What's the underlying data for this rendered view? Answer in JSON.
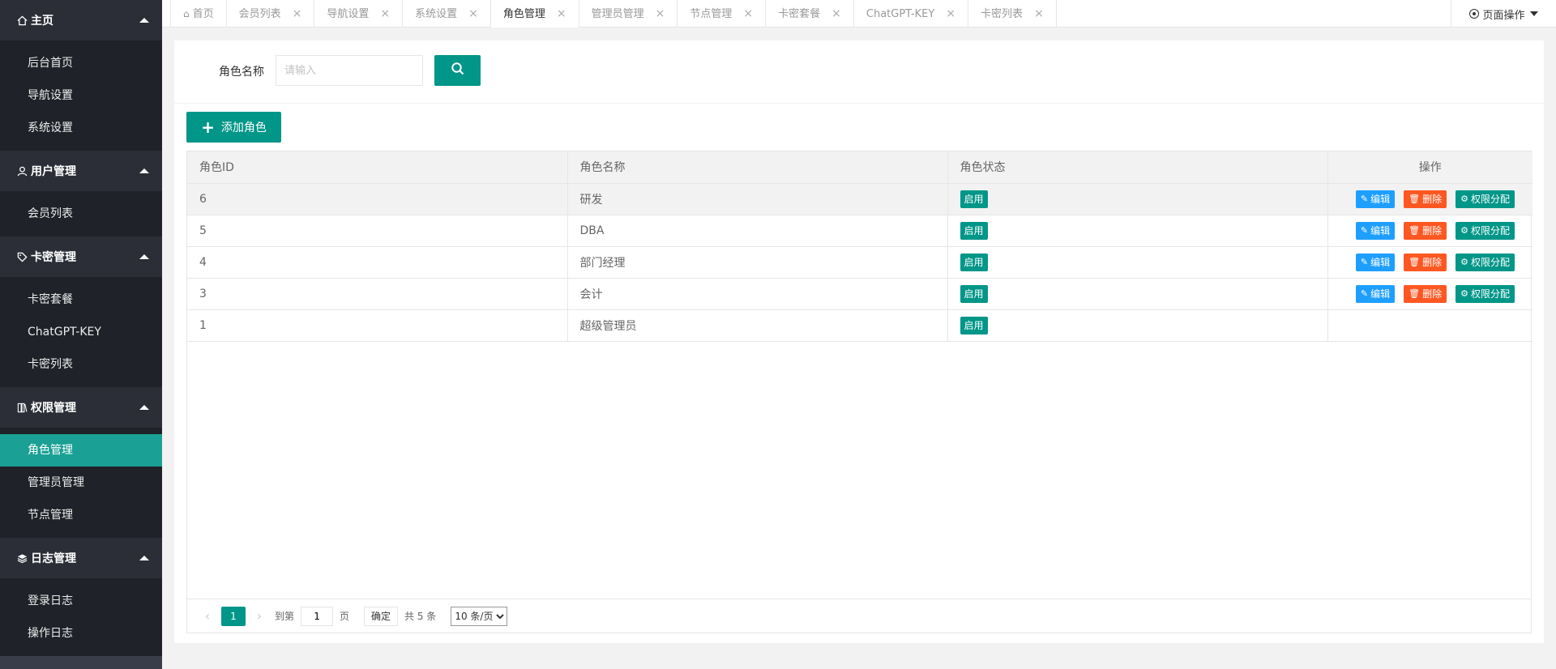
{
  "sidebar": {
    "groups": [
      {
        "label": "主页",
        "icon": "home-icon",
        "items": [
          "后台首页",
          "导航设置",
          "系统设置"
        ]
      },
      {
        "label": "用户管理",
        "icon": "user-icon",
        "items": [
          "会员列表"
        ]
      },
      {
        "label": "卡密管理",
        "icon": "tag-icon",
        "items": [
          "卡密套餐",
          "ChatGPT-KEY",
          "卡密列表"
        ]
      },
      {
        "label": "权限管理",
        "icon": "book-icon",
        "items": [
          "角色管理",
          "管理员管理",
          "节点管理"
        ]
      },
      {
        "label": "日志管理",
        "icon": "layers-icon",
        "items": [
          "登录日志",
          "操作日志"
        ]
      }
    ],
    "active_item": "角色管理"
  },
  "tabs": [
    {
      "label": "首页",
      "closable": false
    },
    {
      "label": "会员列表",
      "closable": true
    },
    {
      "label": "导航设置",
      "closable": true
    },
    {
      "label": "系统设置",
      "closable": true
    },
    {
      "label": "角色管理",
      "closable": true,
      "active": true
    },
    {
      "label": "管理员管理",
      "closable": true
    },
    {
      "label": "节点管理",
      "closable": true
    },
    {
      "label": "卡密套餐",
      "closable": true
    },
    {
      "label": "ChatGPT-KEY",
      "closable": true
    },
    {
      "label": "卡密列表",
      "closable": true
    }
  ],
  "page_ops_label": "页面操作",
  "search": {
    "label": "角色名称",
    "placeholder": "请输入",
    "value": ""
  },
  "add_button_label": "添加角色",
  "table": {
    "columns": [
      "角色ID",
      "角色名称",
      "角色状态",
      "操作"
    ],
    "rows": [
      {
        "id": "6",
        "name": "研发",
        "status": "启用",
        "actions": true
      },
      {
        "id": "5",
        "name": "DBA",
        "status": "启用",
        "actions": true
      },
      {
        "id": "4",
        "name": "部门经理",
        "status": "启用",
        "actions": true
      },
      {
        "id": "3",
        "name": "会计",
        "status": "启用",
        "actions": true
      },
      {
        "id": "1",
        "name": "超级管理员",
        "status": "启用",
        "actions": false
      }
    ],
    "action_labels": {
      "edit": "编辑",
      "delete": "删除",
      "perm": "权限分配"
    }
  },
  "pager": {
    "current": "1",
    "goto_label": "到第",
    "goto_value": "1",
    "page_suffix": "页",
    "confirm_label": "确定",
    "total_label": "共 5 条",
    "page_size": "10 条/页"
  },
  "colors": {
    "accent": "#009688",
    "active_nav": "#1aa094",
    "edit": "#1e9fff",
    "delete": "#ff5722"
  }
}
